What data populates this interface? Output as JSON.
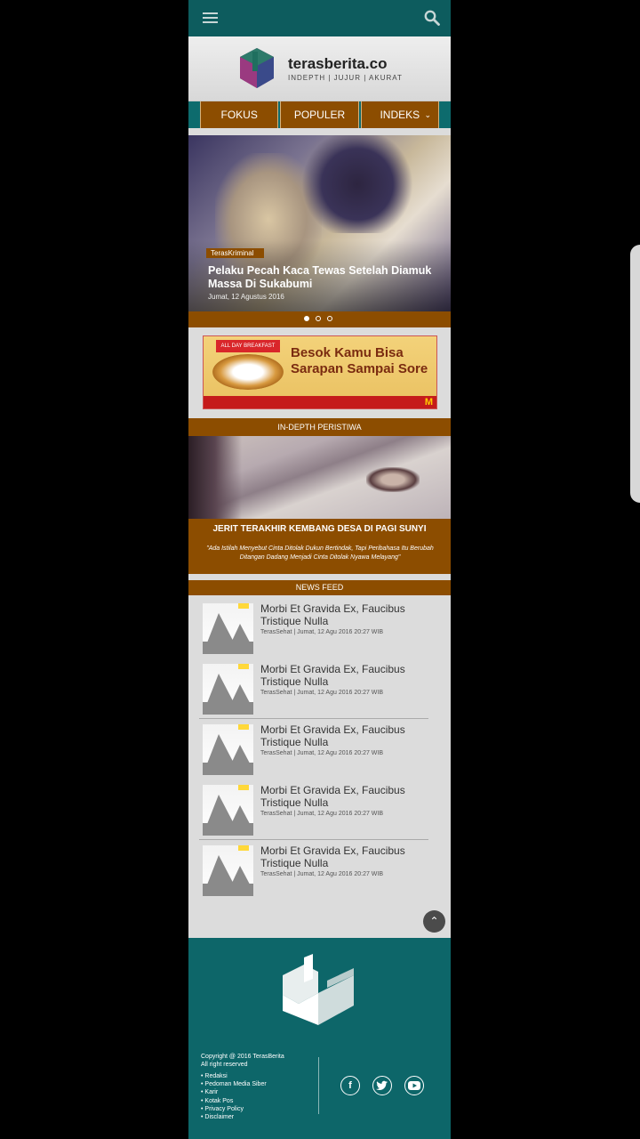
{
  "header": {
    "brand": "terasberita.co",
    "tagline": "INDEPTH | JUJUR | AKURAT"
  },
  "nav": {
    "items": [
      "FOKUS",
      "POPULER",
      "INDEKS"
    ]
  },
  "slider": {
    "category": "TerasKriminal",
    "title": "Pelaku Pecah Kaca Tewas Setelah Diamuk Massa Di Sukabumi",
    "date": "Jumat, 12 Agustus 2016",
    "slide_count": 3,
    "active_slide": 1
  },
  "ad": {
    "ribbon": "ALL DAY BREAKFAST",
    "headline1": "Besok Kamu Bisa",
    "headline2": "Sarapan Sampai Sore",
    "brand": "M"
  },
  "indepth": {
    "section_label": "IN-DEPTH PERISTIWA",
    "title": "JERIT TERAKHIR KEMBANG DESA DI PAGI SUNYI",
    "description": "\"Ada Istilah Menyebut Cinta Ditolak Dukun Bertindak, Tapi Peribahasa Itu Berubah Ditangan Dadang Menjadi Cinta Ditolak Nyawa Melayang\""
  },
  "feed": {
    "section_label": "NEWS FEED",
    "items": [
      {
        "title": "Morbi Et Gravida Ex, Faucibus Tristique Nulla",
        "meta": "TerasSehat | Jumat, 12 Agu 2016 20:27 WIB"
      },
      {
        "title": "Morbi Et Gravida Ex, Faucibus Tristique Nulla",
        "meta": "TerasSehat | Jumat, 12 Agu 2016 20:27 WIB"
      },
      {
        "title": "Morbi Et Gravida Ex, Faucibus Tristique Nulla",
        "meta": "TerasSehat | Jumat, 12 Agu 2016 20:27 WIB"
      },
      {
        "title": "Morbi Et Gravida Ex, Faucibus Tristique Nulla",
        "meta": "TerasSehat | Jumat, 12 Agu 2016 20:27 WIB"
      },
      {
        "title": "Morbi Et Gravida Ex, Faucibus Tristique Nulla",
        "meta": "TerasSehat | Jumat, 12 Agu 2016 20:27 WIB"
      }
    ]
  },
  "footer": {
    "copyright": "Copyright @ 2016 TerasBerita",
    "rights": "All right reserved",
    "links": [
      "Redaksi",
      "Pedoman Media Siber",
      "Karir",
      "Kotak Pos",
      "Privacy Policy",
      "Disclaimer"
    ],
    "social": [
      "facebook-icon",
      "twitter-icon",
      "youtube-icon"
    ]
  },
  "colors": {
    "teal": "#0d5c5e",
    "brown": "#8c4d00",
    "background": "#dcdcdc"
  }
}
